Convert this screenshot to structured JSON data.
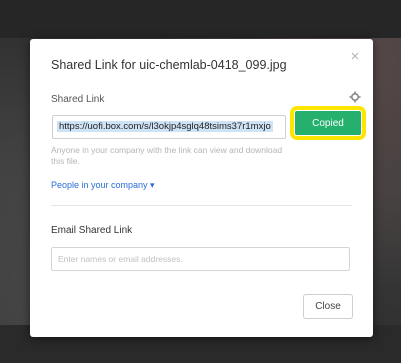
{
  "dialog": {
    "title": "Shared Link for uic-chemlab-0418_099.jpg",
    "close_icon": "×",
    "shared_link_label": "Shared Link",
    "settings_icon": "gear-icon",
    "link_value": "https://uofi.box.com/s/l3okjp4sglq48tsims37r1mxjo",
    "copy_button_label": "Copied",
    "hint_text": "Anyone in your company with the link can view and download this file.",
    "permission_link": "People in your company ▾",
    "email_label": "Email Shared Link",
    "email_placeholder": "Enter names or email addresses.",
    "close_button_label": "Close"
  },
  "colors": {
    "copied_button": "#26b06d",
    "highlight": "#ffe600",
    "link": "#2a6dd8"
  }
}
